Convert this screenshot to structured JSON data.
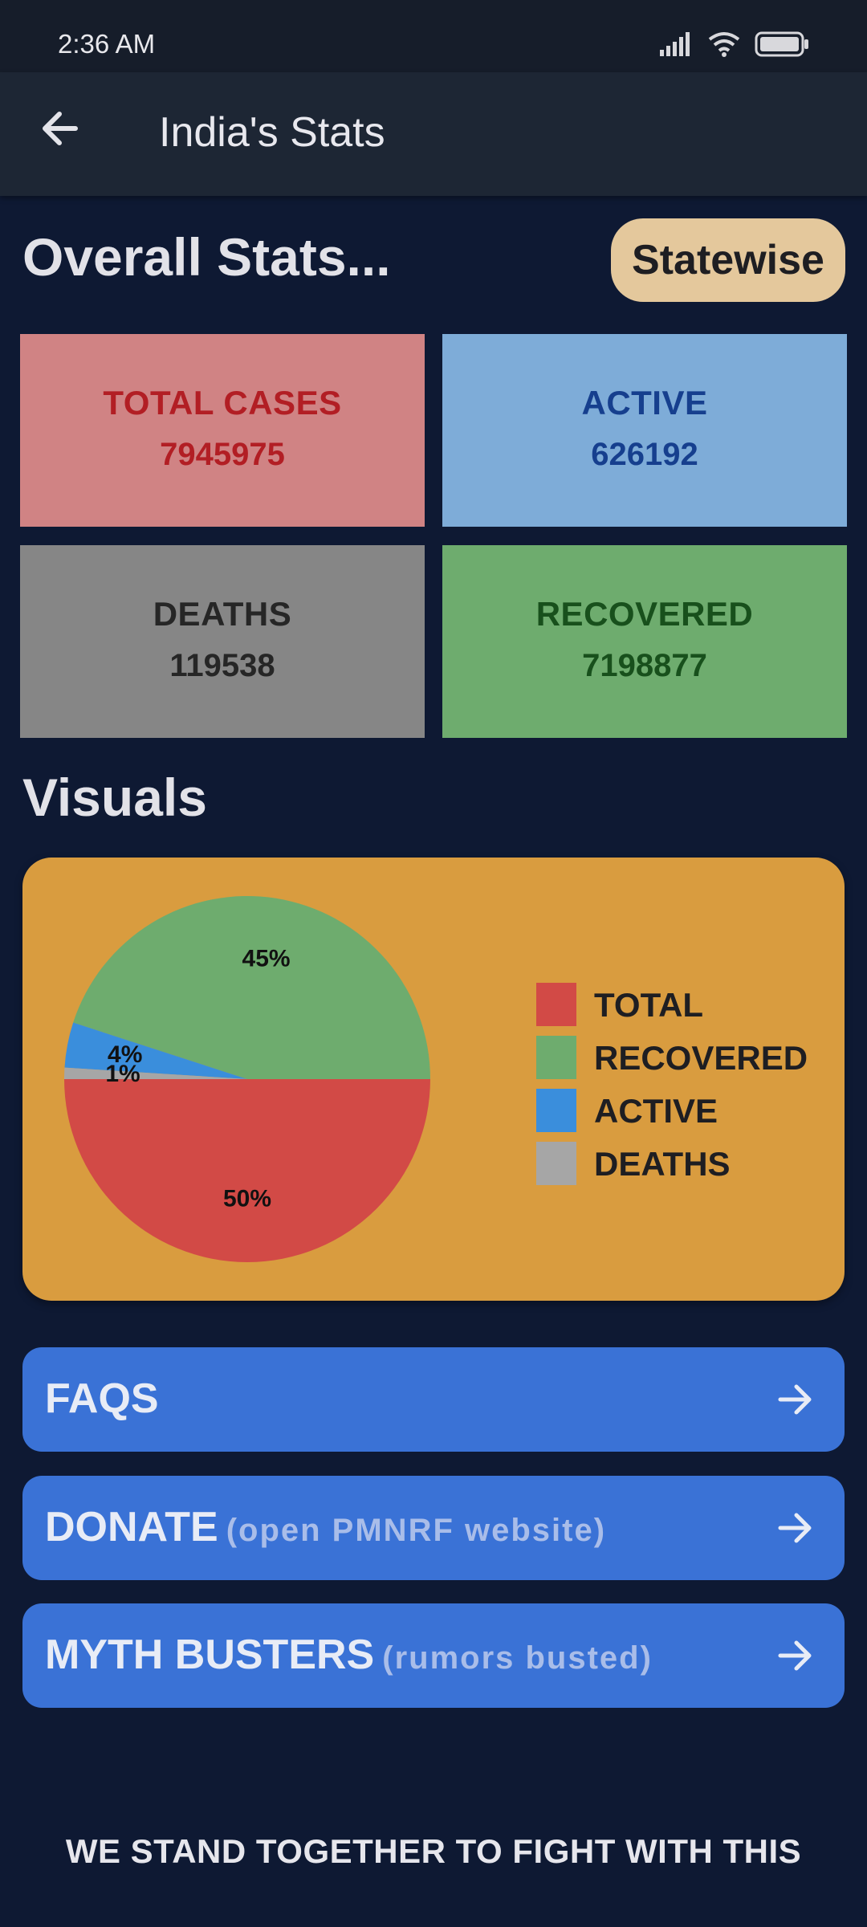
{
  "status_bar": {
    "time": "2:36 AM",
    "icons": [
      "signal-icon",
      "wifi-icon",
      "battery-icon"
    ]
  },
  "app_bar": {
    "title": "India's Stats",
    "back_icon": "arrow-left-icon"
  },
  "overall": {
    "heading": "Overall Stats...",
    "statewise_button": "Statewise",
    "cards": [
      {
        "label": "TOTAL CASES",
        "value": "7945975",
        "bg": "#d08384",
        "fg": "#b21e24"
      },
      {
        "label": "ACTIVE",
        "value": "626192",
        "bg": "#7eacd8",
        "fg": "#163f8e"
      },
      {
        "label": "DEATHS",
        "value": "119538",
        "bg": "#868686",
        "fg": "#262626"
      },
      {
        "label": "RECOVERED",
        "value": "7198877",
        "bg": "#6eac6e",
        "fg": "#18501c"
      }
    ]
  },
  "visuals": {
    "heading": "Visuals",
    "card_bg": "#d99c3f"
  },
  "chart_data": {
    "type": "pie",
    "slices": [
      {
        "name": "TOTAL",
        "value": 50,
        "label": "50%",
        "color": "#d24a46"
      },
      {
        "name": "RECOVERED",
        "value": 45,
        "label": "45%",
        "color": "#6eac6e"
      },
      {
        "name": "ACTIVE",
        "value": 4,
        "label": "4%",
        "color": "#3a8edc"
      },
      {
        "name": "DEATHS",
        "value": 1,
        "label": "1%",
        "color": "#a6a6a6"
      }
    ],
    "legend": [
      "TOTAL",
      "RECOVERED",
      "ACTIVE",
      "DEATHS"
    ],
    "legend_placement": "right"
  },
  "links": [
    {
      "main": "FAQS",
      "sub": ""
    },
    {
      "main": "DONATE",
      "sub": "(open PMNRF website)"
    },
    {
      "main": "MYTH BUSTERS",
      "sub": "(rumors busted)"
    }
  ],
  "footer": "WE STAND TOGETHER TO FIGHT WITH THIS"
}
